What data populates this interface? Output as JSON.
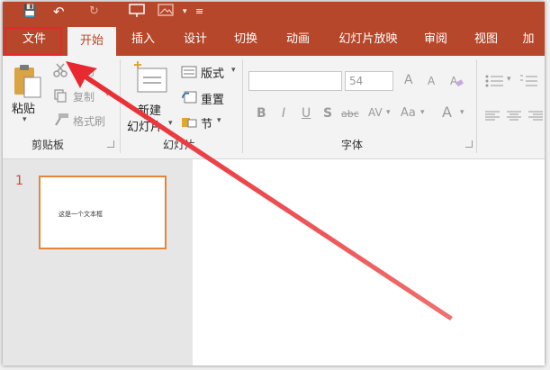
{
  "quick_access": [
    "💾",
    "↶",
    "↻"
  ],
  "tabs": [
    {
      "label": "文件"
    },
    {
      "label": "开始"
    },
    {
      "label": "插入"
    },
    {
      "label": "设计"
    },
    {
      "label": "切换"
    },
    {
      "label": "动画"
    },
    {
      "label": "幻灯片放映"
    },
    {
      "label": "审阅"
    },
    {
      "label": "视图"
    },
    {
      "label": "加"
    }
  ],
  "ribbon": {
    "clipboard": {
      "paste": "粘贴",
      "cut": "剪切",
      "copy": "复制",
      "format_painter": "格式刷",
      "group_label": "剪贴板"
    },
    "slides": {
      "new_slide_line1": "新建",
      "new_slide_line2": "幻灯片",
      "layout": "版式",
      "reset": "重置",
      "section": "节",
      "group_label": "幻灯片"
    },
    "font": {
      "font_name_placeholder": "",
      "font_size": "54",
      "bold": "B",
      "italic": "I",
      "underline": "U",
      "shadow": "S",
      "strike": "abc",
      "spacing": "AV",
      "case": "Aa",
      "color": "A",
      "grow": "A",
      "shrink": "A",
      "group_label": "字体"
    }
  },
  "slides_panel": {
    "slide_number": "1",
    "thumb_text": "这是一个文本框"
  },
  "colors": {
    "accent": "#b7472a",
    "highlight_box": "#e8262d",
    "arrow": "#e8262d",
    "thumb_border": "#e5853a"
  }
}
